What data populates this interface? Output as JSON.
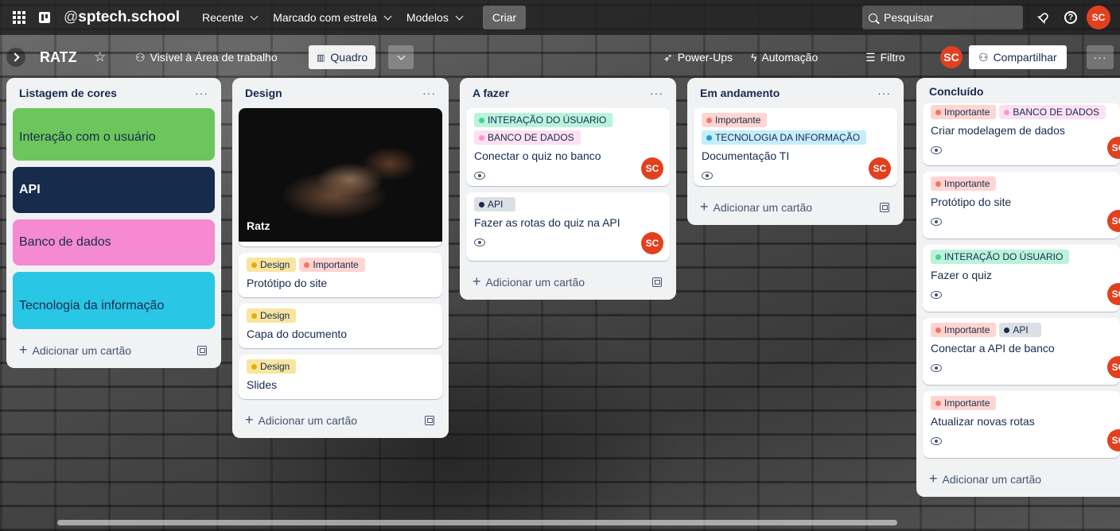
{
  "header": {
    "workspace_at": "@",
    "workspace_name": "sptech.school",
    "menus": [
      {
        "label": "Recente"
      },
      {
        "label": "Marcado com estrela"
      },
      {
        "label": "Modelos"
      }
    ],
    "create_label": "Criar",
    "search_placeholder": "Pesquisar",
    "avatar_initials": "SC"
  },
  "board": {
    "title": "RATZ",
    "visibility_label": "Visível à Área de trabalho",
    "view_label": "Quadro",
    "powerups_label": "Power-Ups",
    "automation_label": "Automação",
    "filter_label": "Filtro",
    "avatar_initials": "SC",
    "share_label": "Compartilhar",
    "more_label": "···"
  },
  "colors": {
    "green_label": "#4bce97",
    "green_label_bg": "#baf3db",
    "pink_label_bg": "#fde1f2",
    "pink_dot": "#f797d2",
    "red_label_bg": "#ffd5d2",
    "red_dot": "#f87462",
    "yellow_label_bg": "#f8e6a0",
    "yellow_dot": "#e2b203",
    "cyan_label_bg": "#c6edfb",
    "cyan_dot": "#1d9fd8",
    "grey_label_bg": "#dcdfe4",
    "navy_dot": "#1d2b4a",
    "avatar": "#e2401f"
  },
  "lists": [
    {
      "title": "Listagem de cores",
      "menu": "···",
      "color_cards": [
        {
          "label": "Interação com o usuário",
          "bg": "#6cc65b",
          "fg": "#172b4d",
          "bold": false
        },
        {
          "label": "API",
          "bg": "#172b4d",
          "fg": "#ffffff",
          "bold": true
        },
        {
          "label": "Banco de dados",
          "bg": "#f589d2",
          "fg": "#172b4d",
          "bold": false
        },
        {
          "label": "Tecnologia da informação",
          "bg": "#29c6e6",
          "fg": "#172b4d",
          "bold": false
        }
      ],
      "add_label": "Adicionar um cartão"
    },
    {
      "title": "Design",
      "menu": "···",
      "cover_card": {
        "title": "Ratz"
      },
      "cards": [
        {
          "title": "Protótipo do site",
          "labels": [
            {
              "text": "Design",
              "kind": "yellow"
            },
            {
              "text": "Importante",
              "kind": "red"
            }
          ]
        },
        {
          "title": "Capa do documento",
          "labels": [
            {
              "text": "Design",
              "kind": "yellow"
            }
          ]
        },
        {
          "title": "Slides",
          "labels": [
            {
              "text": "Design",
              "kind": "yellow"
            }
          ]
        }
      ],
      "add_label": "Adicionar um cartão"
    },
    {
      "title": "A fazer",
      "menu": "···",
      "cards": [
        {
          "title": "Conectar o quiz no banco",
          "labels": [
            {
              "text": "INTERAÇÃO DO ÚSUARIO",
              "kind": "green"
            },
            {
              "text": "BANCO DE DADOS",
              "kind": "pink"
            }
          ],
          "avatar": "SC"
        },
        {
          "title": "Fazer as rotas do quiz na API",
          "labels": [
            {
              "text": "API",
              "kind": "navy"
            }
          ],
          "avatar": "SC"
        }
      ],
      "add_label": "Adicionar um cartão"
    },
    {
      "title": "Em andamento",
      "menu": "···",
      "cards": [
        {
          "title": "Documentação TI",
          "labels": [
            {
              "text": "Importante",
              "kind": "red"
            },
            {
              "text": "TECNOLOGIA DA INFORMAÇÃO",
              "kind": "cyan"
            }
          ],
          "avatar": "SC"
        }
      ],
      "add_label": "Adicionar um cartão"
    },
    {
      "title": "Concluído",
      "cards": [
        {
          "title": "Criar modelagem de dados",
          "labels": [
            {
              "text": "Importante",
              "kind": "red"
            },
            {
              "text": "BANCO DE DADOS",
              "kind": "pink"
            }
          ],
          "avatar": "SC"
        },
        {
          "title": "Protótipo do site",
          "labels": [
            {
              "text": "Importante",
              "kind": "red"
            }
          ],
          "avatar": "SC"
        },
        {
          "title": "Fazer o quiz",
          "labels": [
            {
              "text": "INTERAÇÃO DO ÚSUARIO",
              "kind": "green"
            }
          ],
          "avatar": "SC"
        },
        {
          "title": "Conectar a API de banco",
          "labels": [
            {
              "text": "Importante",
              "kind": "red"
            },
            {
              "text": "API",
              "kind": "navy"
            }
          ],
          "avatar": "SC"
        },
        {
          "title": "Atualizar novas rotas",
          "labels": [
            {
              "text": "Importante",
              "kind": "red"
            }
          ],
          "avatar": "SC"
        }
      ],
      "add_label": "Adicionar um cartão"
    }
  ]
}
